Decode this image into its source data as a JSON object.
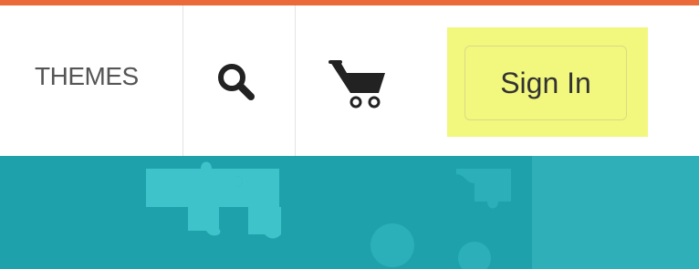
{
  "colors": {
    "accent_bar": "#ea6a3a",
    "highlight": "#f2f77d",
    "banner": "#1fa1ab",
    "banner_right": "#2fb0b8",
    "puzzle_piece": "#3fc3cb",
    "icon": "#222222"
  },
  "nav": {
    "themes_label": "THEMES",
    "search_icon": "search-icon",
    "cart_icon": "cart-icon"
  },
  "auth": {
    "signin_label": "Sign In"
  }
}
